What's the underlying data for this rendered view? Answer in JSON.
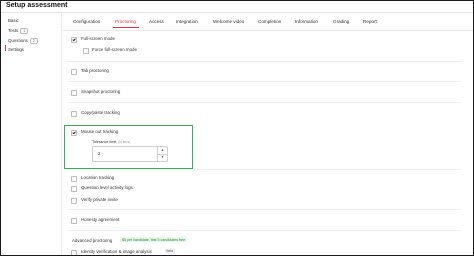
{
  "header": {
    "title": "Setup assessment"
  },
  "sidebar": {
    "items": [
      {
        "label": "Basic"
      },
      {
        "label": "Tests",
        "count": "1"
      },
      {
        "label": "Questions",
        "count": "2"
      },
      {
        "label": "Settings"
      }
    ]
  },
  "tabs": [
    {
      "label": "Configuration"
    },
    {
      "label": "Proctoring"
    },
    {
      "label": "Access"
    },
    {
      "label": "Integration"
    },
    {
      "label": "Welcome video"
    },
    {
      "label": "Completion"
    },
    {
      "label": "Information"
    },
    {
      "label": "Grading"
    },
    {
      "label": "Report"
    }
  ],
  "options": {
    "full_screen": {
      "label": "Full-screen mode",
      "checked": true
    },
    "force_full_screen": {
      "label": "Force full-screen mode",
      "checked": false
    },
    "tab_proctoring": {
      "label": "Tab proctoring",
      "checked": false
    },
    "snapshot_proctoring": {
      "label": "Snapshot proctoring",
      "checked": false
    },
    "copy_paste": {
      "label": "Copy/paste tracking",
      "checked": false
    },
    "mouse_out": {
      "label": "Mouse out tracking",
      "checked": true
    },
    "location": {
      "label": "Location tracking",
      "checked": false
    },
    "question_logs": {
      "label": "Question level activity logs",
      "checked": false
    },
    "private_invite": {
      "label": "Verify private invite",
      "checked": false
    },
    "honesty": {
      "label": "Honesty agreement",
      "checked": false
    },
    "identity": {
      "label": "Identity verification & image analysis",
      "checked": false
    }
  },
  "tolerance": {
    "label": "Tolerance limit",
    "hint": "(in secs)",
    "value": "2",
    "step_up": "▲",
    "step_down": "▼"
  },
  "advanced": {
    "title": "Advanced proctoring",
    "price": "$5 per candidate, first 5 candidates free",
    "beta": "Beta"
  },
  "colors": {
    "accent": "#e8334a",
    "highlight": "#3cad54"
  }
}
